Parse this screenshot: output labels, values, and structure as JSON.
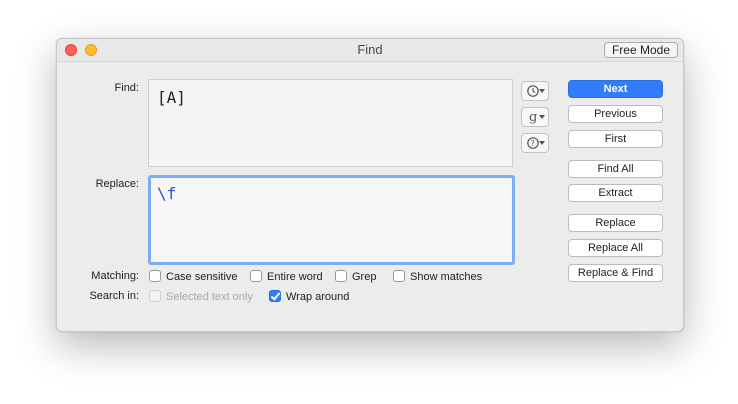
{
  "window": {
    "title": "Find",
    "mode_button": "Free Mode"
  },
  "labels": {
    "find": "Find:",
    "replace": "Replace:",
    "matching": "Matching:",
    "search_in": "Search in:"
  },
  "find_field": {
    "value": "[A]"
  },
  "replace_field": {
    "value": "\\f"
  },
  "popup_buttons": [
    {
      "icon": "clock-icon",
      "glyph": "🕒"
    },
    {
      "icon": "grep-pattern-icon",
      "glyph": "g"
    },
    {
      "icon": "help-icon",
      "glyph": "?"
    }
  ],
  "buttons": {
    "next": "Next",
    "previous": "Previous",
    "first": "First",
    "find_all": "Find All",
    "extract": "Extract",
    "replace": "Replace",
    "replace_all": "Replace All",
    "replace_find": "Replace & Find"
  },
  "matching_options": {
    "case_sensitive": {
      "label": "Case sensitive",
      "checked": false
    },
    "entire_word": {
      "label": "Entire word",
      "checked": false
    },
    "grep": {
      "label": "Grep",
      "checked": false
    },
    "show_matches": {
      "label": "Show matches",
      "checked": false
    }
  },
  "search_in_options": {
    "selected_text_only": {
      "label": "Selected text only",
      "checked": false,
      "enabled": false
    },
    "wrap_around": {
      "label": "Wrap around",
      "checked": true,
      "enabled": true
    }
  },
  "colors": {
    "accent": "#2f7dfa",
    "replace_text": "#2d4fd0",
    "focus_ring": "#7daef0"
  }
}
